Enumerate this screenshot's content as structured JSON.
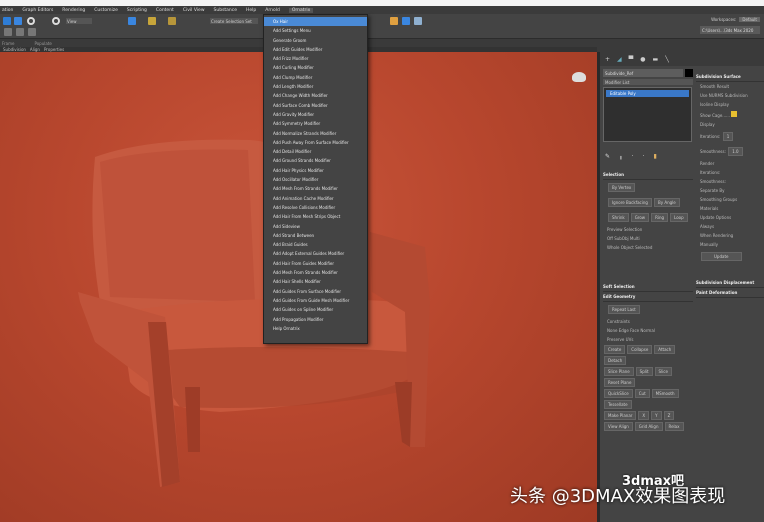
{
  "menubar": [
    "ation",
    "Graph Editors",
    "Rendering",
    "Customize",
    "Scripting",
    "Content",
    "Civil View",
    "Substance",
    "Help",
    "Arnold",
    "Ornatrix"
  ],
  "toolbar": {
    "view_select": "View",
    "selection_set": "Create Selection Set",
    "workspaces_label": "Workspaces:",
    "workspace": "Default",
    "project": "C:\\Users\\...\\3ds Max 2020"
  },
  "ribbon": {
    "labels": [
      "Frame",
      "Populate"
    ],
    "tabs": [
      "Subdivision",
      "Align",
      "Properties"
    ]
  },
  "dropdown": {
    "items": [
      "Ox Hair",
      "Add Settings Menu",
      "Generate Groom",
      "Add Edit Guides Modifier",
      "Add Frizz Modifier",
      "Add Curling Modifier",
      "Add Clump Modifier",
      "Add Length Modifier",
      "Add Change Width Modifier",
      "Add Surface Comb Modifier",
      "Add Gravity Modifier",
      "Add Symmetry Modifier",
      "Add Normalize Strands Modifier",
      "Add Push Away From Surface Modifier",
      "Add Detail Modifier",
      "Add Ground Strands Modifier",
      "Add Hair Physics Modifier",
      "Add Oscillator Modifier",
      "Add Mesh From Strands Modifier",
      "Add Animation Cache Modifier",
      "Add Resolve Collisions Modifier",
      "Add Hair From Mesh Strips Object",
      "Add Sideview",
      "Add Strand Between",
      "Add Braid Guides",
      "Add Adopt External Guides Modifier",
      "Add Hair From Guides Modifier",
      "Add Mesh From Strands Modifier",
      "Add Hair Shells Modifier",
      "Add Guides From Surface Modifier",
      "Add Guides From Guide Mesh Modifier",
      "Add Guides on Spline Modifier",
      "Add Propagation Modifier",
      "Help Ornatrix"
    ],
    "highlighted": 0
  },
  "panel": {
    "name": "Subdivide_Ref",
    "modifier_list": "Modifier List",
    "stack_item": "Editable Poly",
    "selection": {
      "title": "Selection",
      "by_vertex": "By Vertex",
      "ignore_backfacing": "Ignore Backfacing",
      "by_angle": "By Angle",
      "shrink": "Shrink",
      "grow": "Grow",
      "ring": "Ring",
      "loop": "Loop",
      "preview": "Preview Selection",
      "off": "Off",
      "subobj": "SubObj",
      "multi": "Multi",
      "whole": "Whole Object Selected"
    },
    "soft_selection": "Soft Selection",
    "edit_geometry": {
      "title": "Edit Geometry",
      "repeat_last": "Repeat Last",
      "constraints": "Constraints",
      "none": "None",
      "edge": "Edge",
      "face": "Face",
      "normal": "Normal",
      "preserve_uvs": "Preserve UVs",
      "create": "Create",
      "collapse": "Collapse",
      "attach": "Attach",
      "detach": "Detach",
      "slice_plane": "Slice Plane",
      "split": "Split",
      "slice": "Slice",
      "reset_plane": "Reset Plane",
      "quickslice": "QuickSlice",
      "cut": "Cut",
      "msmooth": "MSmooth",
      "tessellate": "Tessellate",
      "make_planar": "Make Planar",
      "x": "X",
      "y": "Y",
      "z": "Z",
      "view_align": "View Align",
      "grid_align": "Grid Align",
      "relax": "Relax"
    },
    "subdivision_surface": {
      "title": "Subdivision Surface",
      "smooth_result": "Smooth Result",
      "use_nurms": "Use NURMS Subdivision",
      "isoline": "Isoline Display",
      "show_cage": "Show Cage......",
      "display": "Display",
      "iterations": "Iterations:",
      "iter_val": "1",
      "smoothness": "Smoothness:",
      "smooth_val": "1.0",
      "render": "Render",
      "separate_by": "Separate By",
      "smoothing_groups": "Smoothing Groups",
      "materials": "Materials",
      "update_options": "Update Options",
      "always": "Always",
      "when_rendering": "When Rendering",
      "manually": "Manually",
      "update": "Update"
    },
    "subdivision_displacement": "Subdivision Displacement",
    "paint_deformation": "Paint Deformation"
  },
  "watermark": {
    "text": "头条 @3DMAX效果图表现",
    "logo": "3dmax吧"
  },
  "colors": {
    "viewport": "#b8472e",
    "highlight": "#4a8ad6",
    "chair": "#c4553c"
  }
}
